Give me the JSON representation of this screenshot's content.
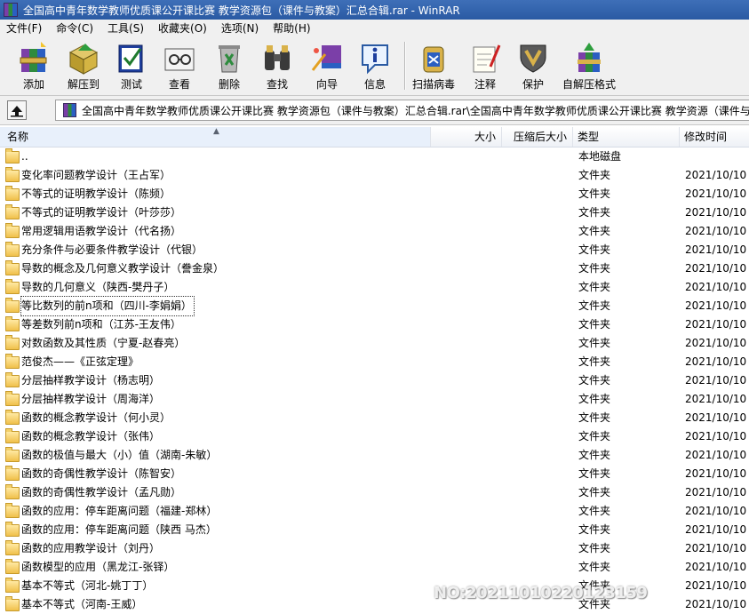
{
  "window": {
    "title": "全国高中青年数学教师优质课公开课比赛 教学资源包（课件与教案）汇总合辑.rar - WinRAR"
  },
  "menu": [
    "文件(F)",
    "命令(C)",
    "工具(S)",
    "收藏夹(O)",
    "选项(N)",
    "帮助(H)"
  ],
  "toolbar": {
    "add": "添加",
    "extract_to": "解压到",
    "test": "测试",
    "view": "查看",
    "delete": "删除",
    "find": "查找",
    "wizard": "向导",
    "info": "信息",
    "virus_scan": "扫描病毒",
    "comment": "注释",
    "protect": "保护",
    "sfx": "自解压格式"
  },
  "address": {
    "path": "全国高中青年数学教师优质课公开课比赛 教学资源包（课件与教案）汇总合辑.rar\\全国高中青年数学教师优质课公开课比赛 教学资源（课件与"
  },
  "columns": {
    "name": "名称",
    "size": "大小",
    "packed": "压缩后大小",
    "type": "类型",
    "modified": "修改时间"
  },
  "files": [
    {
      "name": "..",
      "type": "本地磁盘",
      "modified": ""
    },
    {
      "name": "变化率问题教学设计（王占军）",
      "type": "文件夹",
      "modified": "2021/10/10 ..."
    },
    {
      "name": "不等式的证明教学设计（陈频）",
      "type": "文件夹",
      "modified": "2021/10/10 ..."
    },
    {
      "name": "不等式的证明教学设计（叶莎莎）",
      "type": "文件夹",
      "modified": "2021/10/10 ..."
    },
    {
      "name": "常用逻辑用语教学设计（代名扬）",
      "type": "文件夹",
      "modified": "2021/10/10 ..."
    },
    {
      "name": "充分条件与必要条件教学设计（代银）",
      "type": "文件夹",
      "modified": "2021/10/10 ..."
    },
    {
      "name": "导数的概念及几何意义教学设计（誊金泉）",
      "type": "文件夹",
      "modified": "2021/10/10 ..."
    },
    {
      "name": "导数的几何意义（陕西-樊丹子）",
      "type": "文件夹",
      "modified": "2021/10/10 ..."
    },
    {
      "name": "等比数列的前n项和（四川-李娟娟）",
      "type": "文件夹",
      "modified": "2021/10/10 ..."
    },
    {
      "name": "等差数列前n项和（江苏-王友伟）",
      "type": "文件夹",
      "modified": "2021/10/10 ..."
    },
    {
      "name": "对数函数及其性质（宁夏-赵春亮）",
      "type": "文件夹",
      "modified": "2021/10/10 ..."
    },
    {
      "name": "范俊杰——《正弦定理》",
      "type": "文件夹",
      "modified": "2021/10/10 ..."
    },
    {
      "name": "分层抽样教学设计（杨志明）",
      "type": "文件夹",
      "modified": "2021/10/10 ..."
    },
    {
      "name": "分层抽样教学设计（周海洋）",
      "type": "文件夹",
      "modified": "2021/10/10 ..."
    },
    {
      "name": "函数的概念教学设计（何小灵）",
      "type": "文件夹",
      "modified": "2021/10/10 ..."
    },
    {
      "name": "函数的概念教学设计（张伟）",
      "type": "文件夹",
      "modified": "2021/10/10 ..."
    },
    {
      "name": "函数的极值与最大（小）值（湖南-朱敏）",
      "type": "文件夹",
      "modified": "2021/10/10 ..."
    },
    {
      "name": "函数的奇偶性教学设计（陈智安）",
      "type": "文件夹",
      "modified": "2021/10/10 ..."
    },
    {
      "name": "函数的奇偶性教学设计（孟凡勋）",
      "type": "文件夹",
      "modified": "2021/10/10 ..."
    },
    {
      "name": "函数的应用：停车距离问题（福建-郑林）",
      "type": "文件夹",
      "modified": "2021/10/10 ..."
    },
    {
      "name": "函数的应用：停车距离问题（陕西 马杰）",
      "type": "文件夹",
      "modified": "2021/10/10 ..."
    },
    {
      "name": "函数的应用教学设计（刘丹）",
      "type": "文件夹",
      "modified": "2021/10/10 ..."
    },
    {
      "name": "函数模型的应用（黑龙江-张铎）",
      "type": "文件夹",
      "modified": "2021/10/10 ..."
    },
    {
      "name": "基本不等式（河北-姚丁丁）",
      "type": "文件夹",
      "modified": "2021/10/10 ..."
    },
    {
      "name": "基本不等式（河南-王威）",
      "type": "文件夹",
      "modified": "2021/10/10 ..."
    }
  ],
  "focused_index": 8,
  "watermark": "NO:20211010220123159"
}
